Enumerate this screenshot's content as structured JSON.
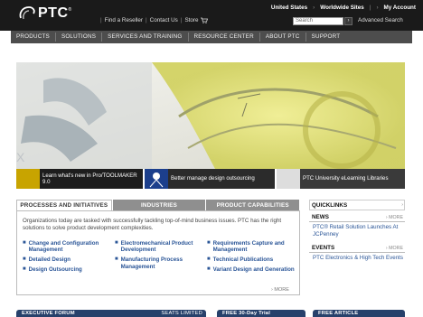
{
  "brand": {
    "logo_text": "PTC",
    "registered": "®"
  },
  "header": {
    "top_links": [
      "Find a Reseller",
      "Contact Us",
      "Store"
    ],
    "store_icon": "cart-icon",
    "country": "United States",
    "worldwide": "Worldwide Sites",
    "my_account": "My Account",
    "search_placeholder": "Search",
    "search_go": "›",
    "advanced_search": "Advanced Search"
  },
  "nav": [
    "PRODUCTS",
    "SOLUTIONS",
    "SERVICES AND TRAINING",
    "RESOURCE CENTER",
    "ABOUT PTC",
    "SUPPORT"
  ],
  "hero": {
    "promos": [
      {
        "text": "Learn what's new in Pro/TOOLMAKER 9.0"
      },
      {
        "text": "Better manage design outsourcing"
      },
      {
        "text": "PTC University eLearning Libraries"
      }
    ]
  },
  "tabs": {
    "items": [
      "PROCESSES AND INITIATIVES",
      "INDUSTRIES",
      "PRODUCT CAPABILITIES"
    ],
    "intro": "Organizations today are tasked with successfully tackling top-of-mind business issues. PTC has the right solutions to solve product development complexities.",
    "columns": [
      [
        "Change and Configuration Management",
        "Detailed Design",
        "Design Outsourcing"
      ],
      [
        "Electromechanical Product Development",
        "Manufacturing Process Management"
      ],
      [
        "Requirements Capture and Management",
        "Technical Publications",
        "Variant Design and Generation"
      ]
    ],
    "more": "MORE"
  },
  "sidebar": {
    "quicklinks": "QUICKLINKS",
    "news_title": "NEWS",
    "news_more": "MORE",
    "news_item": "PTC® Retail Solution Launches At JCPenney",
    "events_title": "EVENTS",
    "events_more": "MORE",
    "events_item": "PTC Electronics & High Tech Events"
  },
  "bottom": {
    "exec_forum": "EXECUTIVE FORUM",
    "seats_limited": "SEATS LIMITED",
    "free_trial": "FREE 30-Day Trial",
    "free_article": "FREE ARTICLE"
  },
  "colors": {
    "header_bg": "#1a1a1a",
    "nav_bg": "#4d4d4d",
    "link": "#2a5597",
    "bar_blue": "#27416b"
  }
}
